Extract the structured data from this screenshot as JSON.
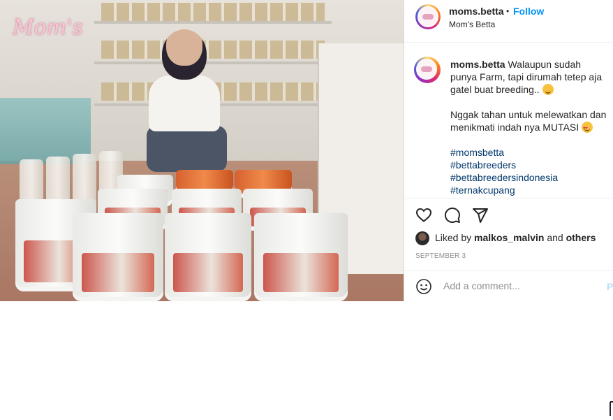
{
  "photo": {
    "alt_logo_text": "Mom's"
  },
  "header": {
    "username": "moms.betta",
    "separator": "•",
    "follow_label": "Follow",
    "location": "Mom's Betta"
  },
  "caption": {
    "username": "moms.betta",
    "line1": "Walaupun sudah punya Farm, tapi dirumah tetep aja gatel buat breeding..",
    "line2": "Nggak tahan untuk melewatkan dan menikmati indah nya MUTASI",
    "hashtags": [
      "#momsbetta",
      "#bettabreeders",
      "#bettabreedersindonesia",
      "#ternakcupang"
    ]
  },
  "actions": {
    "icons": [
      "heart-icon",
      "comment-icon",
      "share-icon"
    ]
  },
  "likes": {
    "prefix": "Liked by",
    "user": "malkos_malvin",
    "conj": "and",
    "others": "others"
  },
  "date": "SEPTEMBER 3",
  "comment": {
    "placeholder": "Add a comment...",
    "post_label": "Post"
  },
  "colors": {
    "link": "#00376b",
    "follow": "#0095f6",
    "muted": "#8e8e8e"
  }
}
